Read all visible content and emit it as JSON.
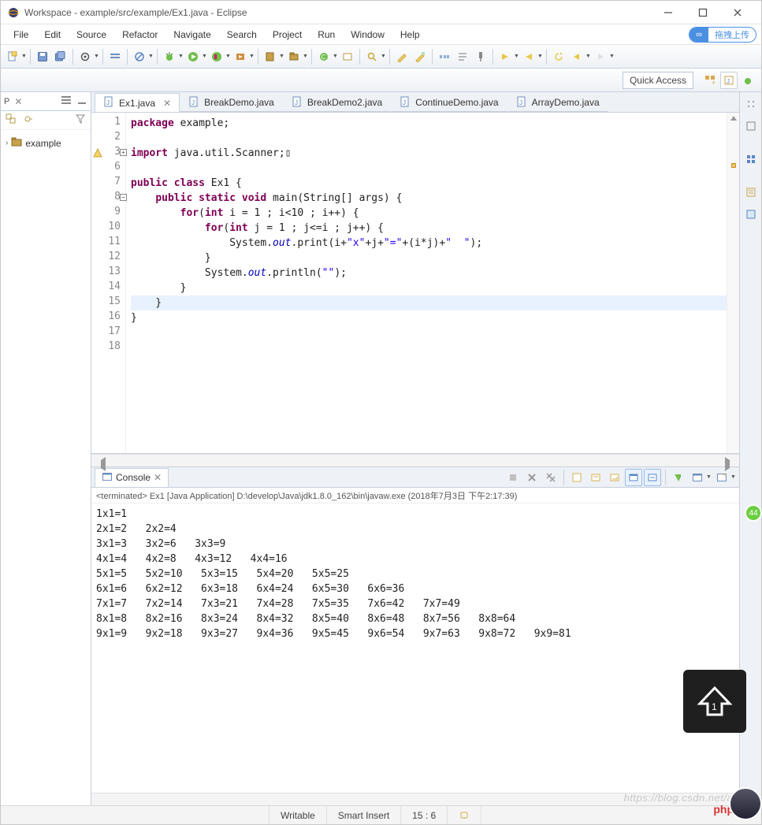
{
  "window": {
    "title": "Workspace - example/src/example/Ex1.java - Eclipse"
  },
  "menu": [
    "File",
    "Edit",
    "Source",
    "Refactor",
    "Navigate",
    "Search",
    "Project",
    "Run",
    "Window",
    "Help"
  ],
  "upload": {
    "label": "拖拽上传"
  },
  "quick_access": {
    "label": "Quick Access"
  },
  "package_explorer": {
    "tab_short": "P",
    "project": "example"
  },
  "editor": {
    "tabs": [
      {
        "label": "Ex1.java",
        "active": true
      },
      {
        "label": "BreakDemo.java",
        "active": false
      },
      {
        "label": "BreakDemo2.java",
        "active": false
      },
      {
        "label": "ContinueDemo.java",
        "active": false
      },
      {
        "label": "ArrayDemo.java",
        "active": false
      }
    ],
    "lines": [
      {
        "n": "1",
        "html": "<span class='kw'>package</span> example;"
      },
      {
        "n": "2",
        "html": ""
      },
      {
        "n": "3",
        "html": "<span class='kw'>import</span> java.util.Scanner;▯",
        "marker": "warning",
        "fold": "+"
      },
      {
        "n": "6",
        "html": ""
      },
      {
        "n": "7",
        "html": "<span class='kw'>public class</span> Ex1 {"
      },
      {
        "n": "8",
        "html": "    <span class='kw'>public static void</span> main(String[] args) {",
        "fold": "-"
      },
      {
        "n": "9",
        "html": "        <span class='kw'>for</span>(<span class='kw'>int</span> i = 1 ; i&lt;10 ; i++) {"
      },
      {
        "n": "10",
        "html": "            <span class='kw'>for</span>(<span class='kw'>int</span> j = 1 ; j&lt;=i ; j++) {"
      },
      {
        "n": "11",
        "html": "                System.<span class='fld'>out</span>.print(i+<span class='str'>\"x\"</span>+j+<span class='str'>\"=\"</span>+(i*j)+<span class='str'>\"  \"</span>);"
      },
      {
        "n": "12",
        "html": "            }"
      },
      {
        "n": "13",
        "html": "            System.<span class='fld'>out</span>.println(<span class='str'>\"\"</span>);"
      },
      {
        "n": "14",
        "html": "        }"
      },
      {
        "n": "15",
        "html": "    }",
        "current": true
      },
      {
        "n": "16",
        "html": "}"
      },
      {
        "n": "17",
        "html": ""
      },
      {
        "n": "18",
        "html": ""
      }
    ]
  },
  "console": {
    "tab": "Console",
    "header": "<terminated> Ex1 [Java Application] D:\\develop\\Java\\jdk1.8.0_162\\bin\\javaw.exe (2018年7月3日 下午2:17:39)",
    "output": "1x1=1\n2x1=2   2x2=4\n3x1=3   3x2=6   3x3=9\n4x1=4   4x2=8   4x3=12   4x4=16\n5x1=5   5x2=10   5x3=15   5x4=20   5x5=25\n6x1=6   6x2=12   6x3=18   6x4=24   6x5=30   6x6=36\n7x1=7   7x2=14   7x3=21   7x4=28   7x5=35   7x6=42   7x7=49\n8x1=8   8x2=16   8x3=24   8x4=32   8x5=40   8x6=48   8x7=56   8x8=64\n9x1=9   9x2=18   9x3=27   9x4=36   9x5=45   9x6=54   9x7=63   9x8=72   9x9=81"
  },
  "status": {
    "writable": "Writable",
    "insert": "Smart Insert",
    "pos": "15 : 6"
  },
  "watermark": "https://blog.csdn.net/ad",
  "green_badge": "44"
}
